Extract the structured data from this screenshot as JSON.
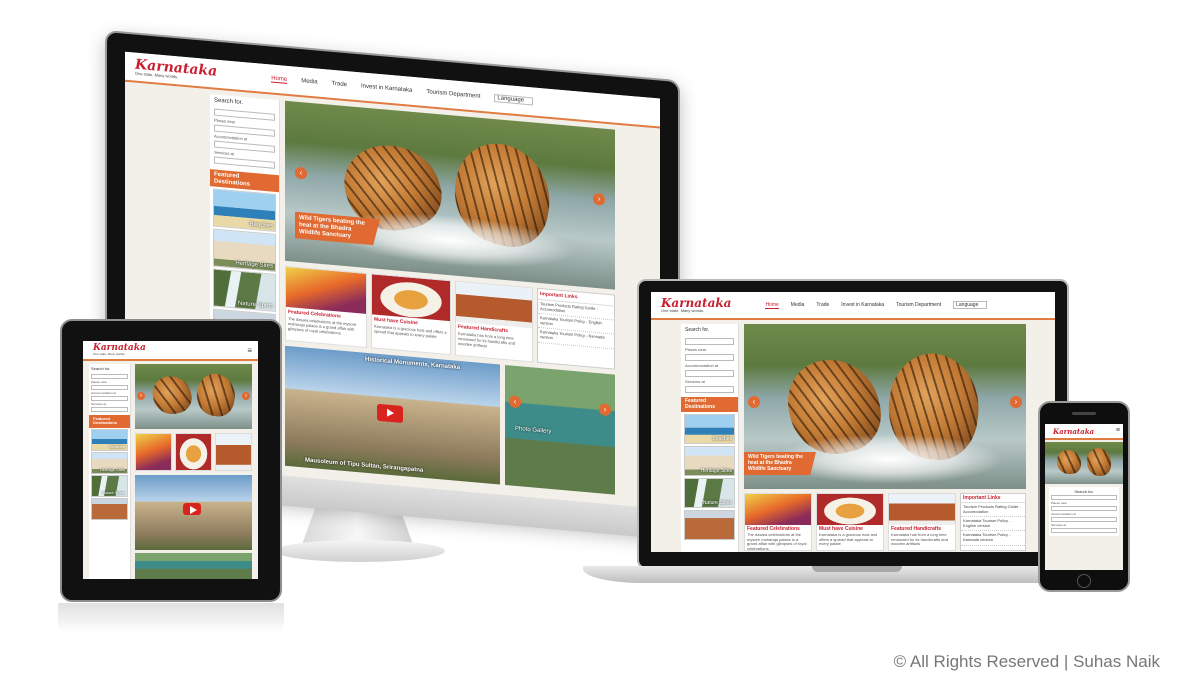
{
  "site": {
    "logo": "Karnataka",
    "tagline": "One state. Many worlds.",
    "nav": [
      "Home",
      "Media",
      "Trade",
      "Invest in Karnataka",
      "Tourism Department"
    ],
    "language": "Language",
    "search_title": "Search for.",
    "keyword_placeholder": "Keyword",
    "places_near": "Places near",
    "destination": "Destination",
    "accommodation_at": "Accommodation at",
    "services_at": "Services at",
    "featured_destinations": "Featured Destinations",
    "destinations": [
      "Beaches",
      "Heritage Sites",
      "Nature Spots"
    ],
    "hero_caption": "Wild Tigers beating the heat at the Bhadra Wildlife Sanctuary",
    "cards": [
      {
        "title": "Featured Celebrations",
        "text": "The dasara celebrations at the mysore maharaja palace is a grand affair with glimpses of royal celebrations"
      },
      {
        "title": "Must have Cuisine",
        "text": "Karnataka is a gracious host and offers a spread that appeals to every palate"
      },
      {
        "title": "Featured Handicrafts",
        "text": "Karnataka has from a long time renowned for its handicrafts and wooden artifacts"
      }
    ],
    "important_links_title": "Important Links",
    "important_links": [
      "Tourism Products Rating Guide - Accomodation",
      "Karnataka Tourism Policy - English version",
      "Karnataka Tourism Policy - Kannada version"
    ],
    "monuments_title": "Historical Monuments, Karnataka",
    "monuments_caption": "Mausoleum of Tipu Sultan, Srirangapatna",
    "photo_gallery": "Photo Gallery"
  },
  "copyright": "© All Rights Reserved | Suhas Naik"
}
